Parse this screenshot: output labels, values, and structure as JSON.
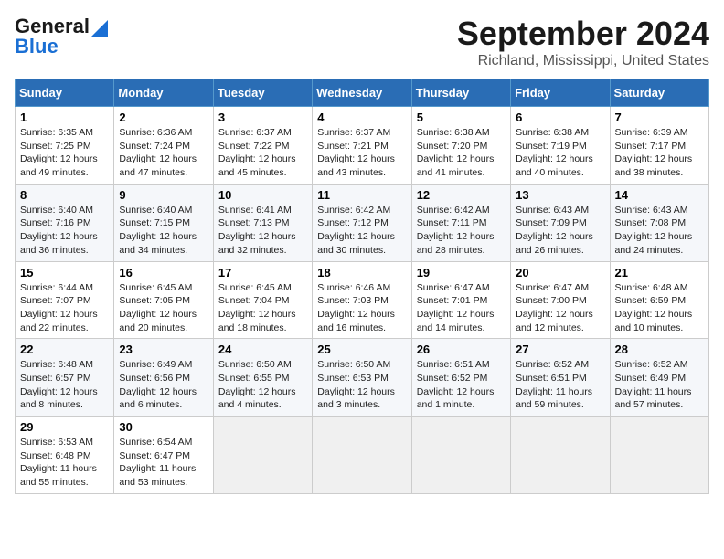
{
  "header": {
    "logo_line1": "General",
    "logo_line2": "Blue",
    "title": "September 2024",
    "subtitle": "Richland, Mississippi, United States"
  },
  "days_of_week": [
    "Sunday",
    "Monday",
    "Tuesday",
    "Wednesday",
    "Thursday",
    "Friday",
    "Saturday"
  ],
  "weeks": [
    [
      {
        "day": "1",
        "text": "Sunrise: 6:35 AM\nSunset: 7:25 PM\nDaylight: 12 hours and 49 minutes."
      },
      {
        "day": "2",
        "text": "Sunrise: 6:36 AM\nSunset: 7:24 PM\nDaylight: 12 hours and 47 minutes."
      },
      {
        "day": "3",
        "text": "Sunrise: 6:37 AM\nSunset: 7:22 PM\nDaylight: 12 hours and 45 minutes."
      },
      {
        "day": "4",
        "text": "Sunrise: 6:37 AM\nSunset: 7:21 PM\nDaylight: 12 hours and 43 minutes."
      },
      {
        "day": "5",
        "text": "Sunrise: 6:38 AM\nSunset: 7:20 PM\nDaylight: 12 hours and 41 minutes."
      },
      {
        "day": "6",
        "text": "Sunrise: 6:38 AM\nSunset: 7:19 PM\nDaylight: 12 hours and 40 minutes."
      },
      {
        "day": "7",
        "text": "Sunrise: 6:39 AM\nSunset: 7:17 PM\nDaylight: 12 hours and 38 minutes."
      }
    ],
    [
      {
        "day": "8",
        "text": "Sunrise: 6:40 AM\nSunset: 7:16 PM\nDaylight: 12 hours and 36 minutes."
      },
      {
        "day": "9",
        "text": "Sunrise: 6:40 AM\nSunset: 7:15 PM\nDaylight: 12 hours and 34 minutes."
      },
      {
        "day": "10",
        "text": "Sunrise: 6:41 AM\nSunset: 7:13 PM\nDaylight: 12 hours and 32 minutes."
      },
      {
        "day": "11",
        "text": "Sunrise: 6:42 AM\nSunset: 7:12 PM\nDaylight: 12 hours and 30 minutes."
      },
      {
        "day": "12",
        "text": "Sunrise: 6:42 AM\nSunset: 7:11 PM\nDaylight: 12 hours and 28 minutes."
      },
      {
        "day": "13",
        "text": "Sunrise: 6:43 AM\nSunset: 7:09 PM\nDaylight: 12 hours and 26 minutes."
      },
      {
        "day": "14",
        "text": "Sunrise: 6:43 AM\nSunset: 7:08 PM\nDaylight: 12 hours and 24 minutes."
      }
    ],
    [
      {
        "day": "15",
        "text": "Sunrise: 6:44 AM\nSunset: 7:07 PM\nDaylight: 12 hours and 22 minutes."
      },
      {
        "day": "16",
        "text": "Sunrise: 6:45 AM\nSunset: 7:05 PM\nDaylight: 12 hours and 20 minutes."
      },
      {
        "day": "17",
        "text": "Sunrise: 6:45 AM\nSunset: 7:04 PM\nDaylight: 12 hours and 18 minutes."
      },
      {
        "day": "18",
        "text": "Sunrise: 6:46 AM\nSunset: 7:03 PM\nDaylight: 12 hours and 16 minutes."
      },
      {
        "day": "19",
        "text": "Sunrise: 6:47 AM\nSunset: 7:01 PM\nDaylight: 12 hours and 14 minutes."
      },
      {
        "day": "20",
        "text": "Sunrise: 6:47 AM\nSunset: 7:00 PM\nDaylight: 12 hours and 12 minutes."
      },
      {
        "day": "21",
        "text": "Sunrise: 6:48 AM\nSunset: 6:59 PM\nDaylight: 12 hours and 10 minutes."
      }
    ],
    [
      {
        "day": "22",
        "text": "Sunrise: 6:48 AM\nSunset: 6:57 PM\nDaylight: 12 hours and 8 minutes."
      },
      {
        "day": "23",
        "text": "Sunrise: 6:49 AM\nSunset: 6:56 PM\nDaylight: 12 hours and 6 minutes."
      },
      {
        "day": "24",
        "text": "Sunrise: 6:50 AM\nSunset: 6:55 PM\nDaylight: 12 hours and 4 minutes."
      },
      {
        "day": "25",
        "text": "Sunrise: 6:50 AM\nSunset: 6:53 PM\nDaylight: 12 hours and 3 minutes."
      },
      {
        "day": "26",
        "text": "Sunrise: 6:51 AM\nSunset: 6:52 PM\nDaylight: 12 hours and 1 minute."
      },
      {
        "day": "27",
        "text": "Sunrise: 6:52 AM\nSunset: 6:51 PM\nDaylight: 11 hours and 59 minutes."
      },
      {
        "day": "28",
        "text": "Sunrise: 6:52 AM\nSunset: 6:49 PM\nDaylight: 11 hours and 57 minutes."
      }
    ],
    [
      {
        "day": "29",
        "text": "Sunrise: 6:53 AM\nSunset: 6:48 PM\nDaylight: 11 hours and 55 minutes."
      },
      {
        "day": "30",
        "text": "Sunrise: 6:54 AM\nSunset: 6:47 PM\nDaylight: 11 hours and 53 minutes."
      },
      {
        "day": "",
        "text": ""
      },
      {
        "day": "",
        "text": ""
      },
      {
        "day": "",
        "text": ""
      },
      {
        "day": "",
        "text": ""
      },
      {
        "day": "",
        "text": ""
      }
    ]
  ]
}
